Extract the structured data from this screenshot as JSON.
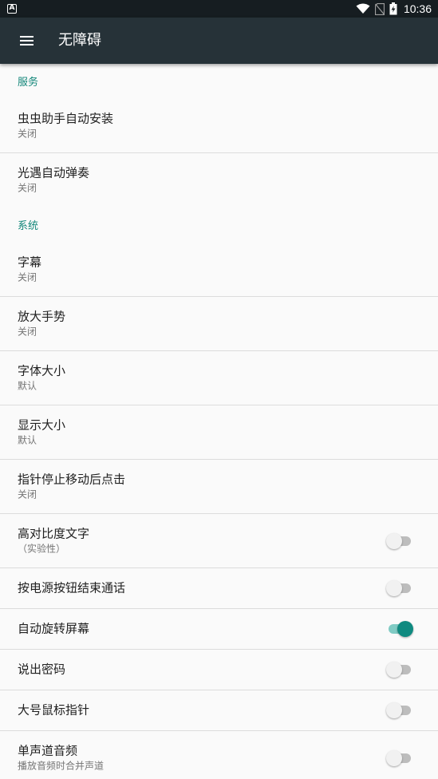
{
  "status_bar": {
    "left_icon": "A",
    "icons": [
      "wifi-icon",
      "no-sim-icon",
      "battery-charging-icon"
    ],
    "time": "10:36"
  },
  "app_bar": {
    "menu_icon": "menu-icon",
    "title": "无障碍"
  },
  "sections": {
    "services": {
      "header": "服务",
      "items": [
        {
          "title": "虫虫助手自动安装",
          "subtitle": "关闭"
        },
        {
          "title": "光遇自动弹奏",
          "subtitle": "关闭"
        }
      ]
    },
    "system": {
      "header": "系统",
      "items": [
        {
          "title": "字幕",
          "subtitle": "关闭"
        },
        {
          "title": "放大手势",
          "subtitle": "关闭"
        },
        {
          "title": "字体大小",
          "subtitle": "默认"
        },
        {
          "title": "显示大小",
          "subtitle": "默认"
        },
        {
          "title": "指针停止移动后点击",
          "subtitle": "关闭"
        }
      ],
      "toggles": [
        {
          "title": "高对比度文字",
          "subtitle": "（实验性）",
          "on": false
        },
        {
          "title": "按电源按钮结束通话",
          "on": false
        },
        {
          "title": "自动旋转屏幕",
          "on": true
        },
        {
          "title": "说出密码",
          "on": false
        },
        {
          "title": "大号鼠标指针",
          "on": false
        },
        {
          "title": "单声道音频",
          "subtitle": "播放音频时合并声道",
          "on": false
        }
      ]
    }
  },
  "colors": {
    "app_bar": "#263238",
    "status_bar": "#161d21",
    "accent": "#14877a",
    "toggle_on": "#0f8a80"
  }
}
